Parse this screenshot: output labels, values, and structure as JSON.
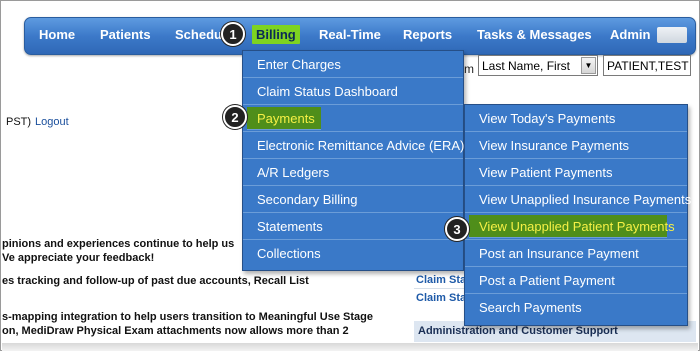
{
  "nav": {
    "items": [
      {
        "label": "Home"
      },
      {
        "label": "Patients"
      },
      {
        "label": "Schedule"
      },
      {
        "label": "Billing"
      },
      {
        "label": "Real-Time"
      },
      {
        "label": "Reports"
      },
      {
        "label": "Tasks & Messages"
      },
      {
        "label": "Admin"
      }
    ],
    "active": "Billing",
    "accent_color": "#7ed321"
  },
  "markers": [
    "1",
    "2",
    "3"
  ],
  "search": {
    "label_suffix": "m",
    "select_value": "Last Name, First",
    "select_arrow": "▼",
    "input_value": "PATIENT,TEST"
  },
  "page": {
    "top_left": "PST)",
    "logout": "Logout",
    "news": [
      "pinions and experiences continue to help us",
      "Ve appreciate your feedback!",
      "es tracking and follow-up of past due accounts, Recall List",
      "s-mapping integration to help users transition to Meaningful Use Stage",
      "on, MediDraw Physical Exam attachments now allows more than 2"
    ],
    "side_links": [
      "Claim Stat",
      "Claim Stat"
    ],
    "admin_header": "Administration and Customer Support"
  },
  "billing_menu": {
    "items": [
      {
        "label": "Enter Charges"
      },
      {
        "label": "Claim Status Dashboard"
      },
      {
        "label": "Payments"
      },
      {
        "label": "Electronic Remittance Advice (ERA)"
      },
      {
        "label": "A/R Ledgers"
      },
      {
        "label": "Secondary Billing"
      },
      {
        "label": "Statements"
      },
      {
        "label": "Collections"
      }
    ],
    "active": "Payments"
  },
  "payments_menu": {
    "items": [
      {
        "label": "View Today's Payments"
      },
      {
        "label": "View Insurance Payments"
      },
      {
        "label": "View Patient Payments"
      },
      {
        "label": "View Unapplied Insurance Payments"
      },
      {
        "label": "View Unapplied Patient Payments"
      },
      {
        "label": "Post an Insurance Payment"
      },
      {
        "label": "Post a Patient Payment"
      },
      {
        "label": "Search Payments"
      }
    ],
    "active": "View Unapplied Patient Payments",
    "highlight_text_color": "#f6f045"
  }
}
